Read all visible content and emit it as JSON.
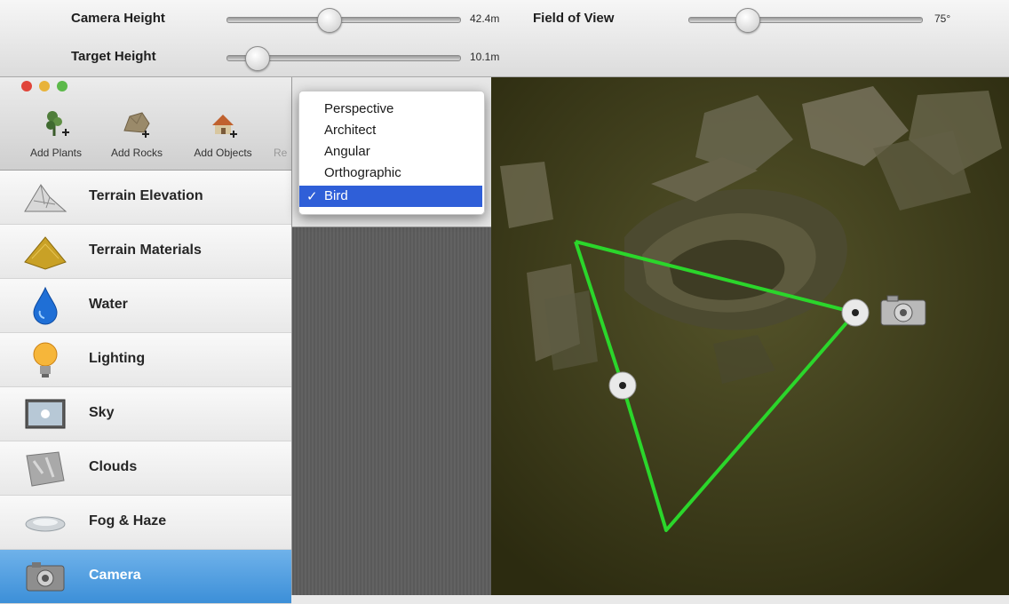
{
  "controls": {
    "camera_height": {
      "label": "Camera Height",
      "value": "42.4m",
      "level_percent": 44
    },
    "target_height": {
      "label": "Target Height",
      "value": "10.1m",
      "level_percent": 13
    },
    "field_of_view": {
      "label": "Field of View",
      "value": "75°",
      "level_percent": 25
    }
  },
  "window": {
    "traffic_lights": [
      "#e0453a",
      "#e8b33a",
      "#5cb94a"
    ]
  },
  "toolbar": {
    "add_plants": "Add Plants",
    "add_rocks": "Add Rocks",
    "add_objects": "Add Objects",
    "clipped": "Re"
  },
  "sidebar": {
    "items": [
      {
        "label": "Terrain Elevation",
        "icon": "terrain-elevation-icon"
      },
      {
        "label": "Terrain Materials",
        "icon": "terrain-materials-icon"
      },
      {
        "label": "Water",
        "icon": "water-drop-icon"
      },
      {
        "label": "Lighting",
        "icon": "light-bulb-icon"
      },
      {
        "label": "Sky",
        "icon": "sky-icon"
      },
      {
        "label": "Clouds",
        "icon": "clouds-icon"
      },
      {
        "label": "Fog & Haze",
        "icon": "fog-icon"
      },
      {
        "label": "Camera",
        "icon": "camera-icon",
        "selected": true
      }
    ]
  },
  "view_menu": {
    "options": [
      "Perspective",
      "Architect",
      "Angular",
      "Orthographic",
      "Bird"
    ],
    "selected": "Bird",
    "check_mark": "✓"
  },
  "colors": {
    "frustum_line": "#2bd62b",
    "selected_item": "#3c8fd8",
    "menu_highlight": "#2f5fd8",
    "map_background": "#3b3a16"
  }
}
